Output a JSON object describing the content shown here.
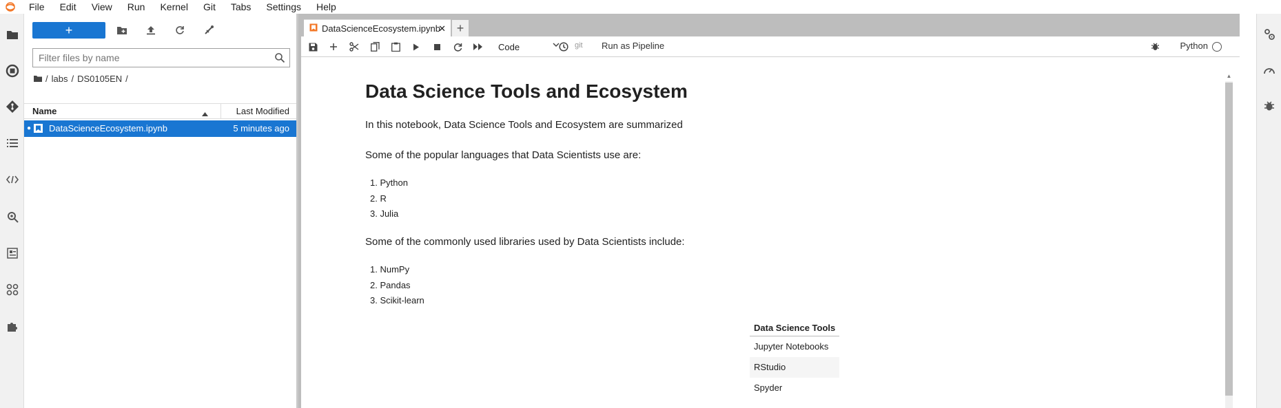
{
  "menubar": {
    "items": [
      "File",
      "Edit",
      "View",
      "Run",
      "Kernel",
      "Git",
      "Tabs",
      "Settings",
      "Help"
    ]
  },
  "left_activity": {
    "icons": [
      "folder-icon",
      "running-icon",
      "git-icon",
      "toc-icon",
      "code-snippets-icon",
      "property-inspector-icon",
      "metadata-icon",
      "components-icon",
      "extensions-icon"
    ]
  },
  "filebrowser": {
    "new_label": "+",
    "search_placeholder": "Filter files by name",
    "breadcrumbs": [
      "/",
      "labs",
      "/",
      "DS0105EN",
      "/"
    ],
    "columns": {
      "name": "Name",
      "modified": "Last Modified"
    },
    "files": [
      {
        "name": "DataScienceEcosystem.ipynb",
        "modified": "5 minutes ago"
      }
    ]
  },
  "tabs": {
    "active_label": "DataScienceEcosystem.ipynb",
    "close_glyph": "✕",
    "add_glyph": "+"
  },
  "toolbar": {
    "cell_type": "Code",
    "git_label": "git",
    "pipeline_label": "Run as Pipeline",
    "kernel_name": "Python"
  },
  "notebook": {
    "title": "Data Science Tools and Ecosystem",
    "intro": "In this notebook, Data Science Tools and Ecosystem are summarized",
    "languages_heading": "Some of the popular languages that Data Scientists use are:",
    "languages": [
      "1. Python",
      "2. R",
      "3. Julia"
    ],
    "libraries_heading": "Some of the commonly used libraries used by Data Scientists include:",
    "libraries": [
      "1. NumPy",
      "2. Pandas",
      "3. Scikit-learn"
    ],
    "tools_table": {
      "header": "Data Science Tools",
      "rows": [
        "Jupyter Notebooks",
        "RStudio",
        "Spyder"
      ]
    }
  },
  "right_activity": {
    "icons": [
      "property-inspector-icon",
      "resource-usage-icon",
      "debugger-icon"
    ]
  },
  "colors": {
    "accent": "#1976d2",
    "tab_bar": "#bdbdbd",
    "activity_bar": "#f1f1f1"
  }
}
